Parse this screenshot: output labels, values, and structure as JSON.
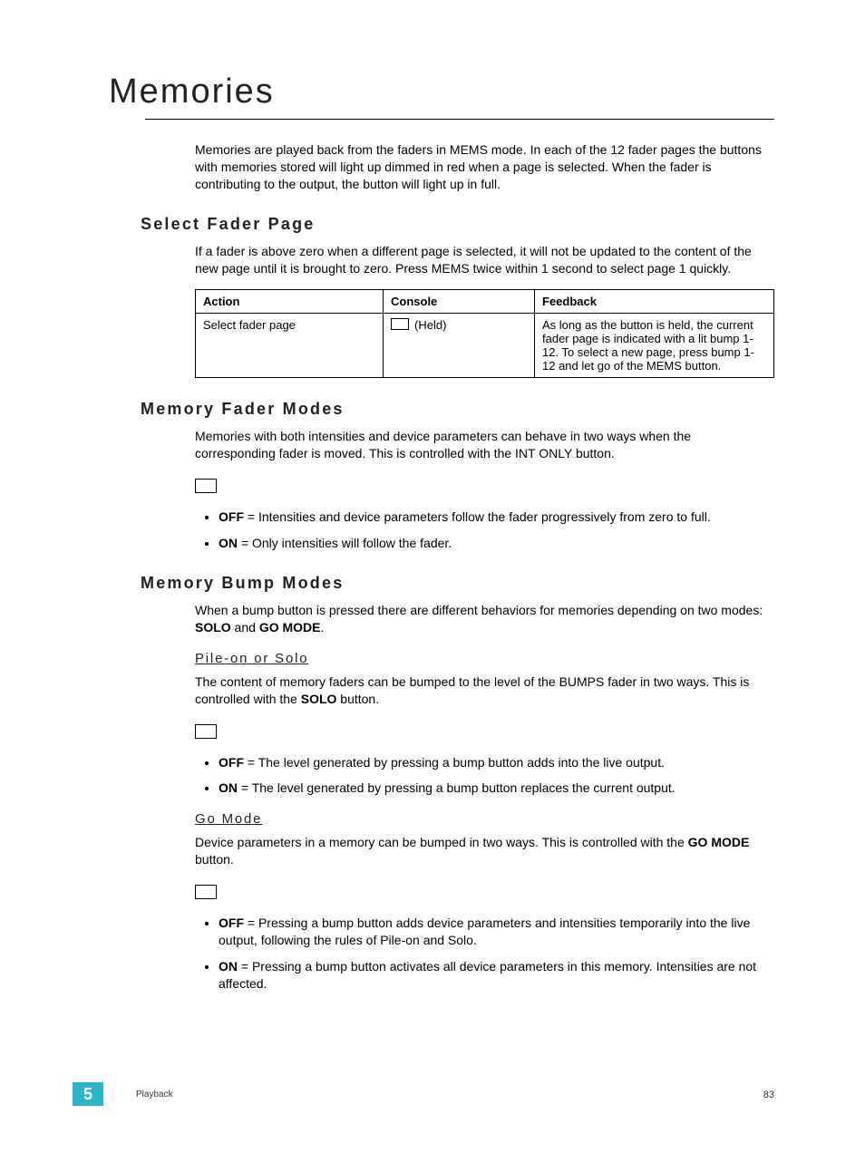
{
  "title": "Memories",
  "intro": "Memories are played back from the faders in MEMS mode. In each of the 12 fader pages the buttons with memories stored will light up dimmed in red when a page is selected. When the fader is contributing to the output, the button will light up in full.",
  "select_fader": {
    "heading": "Select Fader Page",
    "para": "If a fader is above zero when a different page is selected, it will not be updated to the content of the new page until it is brought to zero. Press MEMS twice within 1 second to select page 1 quickly.",
    "table_headers": {
      "action": "Action",
      "console": "Console",
      "feedback": "Feedback"
    },
    "row": {
      "action": "Select fader page",
      "console_held": "(Held)",
      "feedback": "As long as the button is held, the current fader page is indicated with a lit bump 1-12. To select a new page, press bump 1-12 and let go of the MEMS button."
    }
  },
  "fader_modes": {
    "heading": "Memory Fader Modes",
    "para": "Memories with both intensities and device parameters can behave in two ways when the corresponding fader is moved. This is controlled with the INT ONLY button.",
    "items": [
      {
        "label": "OFF",
        "text": " = Intensities and device parameters follow the fader progressively from zero to full."
      },
      {
        "label": "ON",
        "text": " = Only intensities will follow the fader."
      }
    ]
  },
  "bump_modes": {
    "heading": "Memory Bump Modes",
    "para_pre": "When a bump button is pressed there are different behaviors for memories depending on two modes: ",
    "mode1": "SOLO",
    "and": " and ",
    "mode2": "GO MODE",
    "period": ".",
    "pile": {
      "heading": "Pile-on or Solo",
      "para_pre": "The content of memory faders can be bumped to the level of the BUMPS fader in two ways. This is controlled with the ",
      "btn": "SOLO",
      "para_post": " button.",
      "items": [
        {
          "label": "OFF",
          "text": " = The level generated by pressing a bump button adds into the live output."
        },
        {
          "label": "ON",
          "text": " = The level generated by pressing a bump button replaces the current output."
        }
      ]
    },
    "go": {
      "heading": "Go Mode",
      "para_pre": "Device parameters in a memory can be bumped in two ways. This is controlled with the ",
      "btn": "GO MODE",
      "para_post": " button.",
      "items": [
        {
          "label": "OFF",
          "text": " = Pressing a bump button adds device parameters and intensities temporarily into the live output, following the rules of Pile-on and Solo."
        },
        {
          "label": "ON",
          "text": " = Pressing a bump button activates all device parameters in this memory. Intensities are not affected."
        }
      ]
    }
  },
  "footer": {
    "chapter": "5",
    "section": "Playback",
    "page": "83"
  }
}
